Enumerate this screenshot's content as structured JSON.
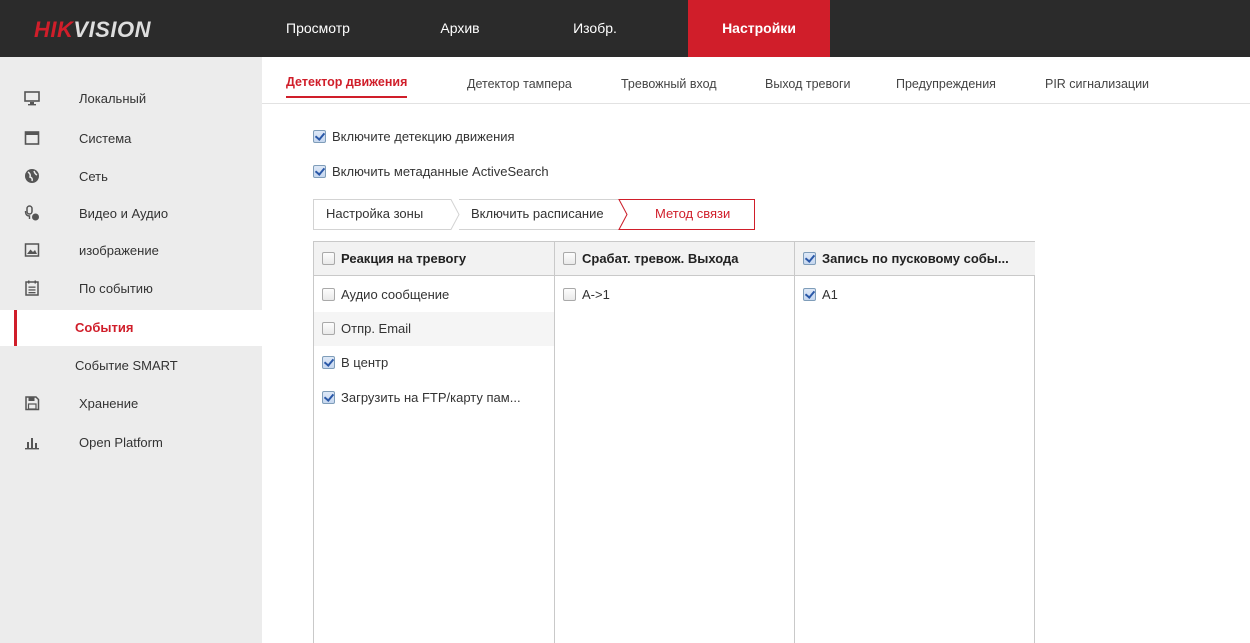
{
  "brand": {
    "logo_red": "HIK",
    "logo_rest": "VISION"
  },
  "topnav": [
    {
      "label": "Просмотр",
      "active": false
    },
    {
      "label": "Архив",
      "active": false
    },
    {
      "label": "Изобр.",
      "active": false
    },
    {
      "label": "Настройки",
      "active": true
    }
  ],
  "sidebar": [
    {
      "label": "Локальный",
      "icon": "monitor-icon"
    },
    {
      "label": "Система",
      "icon": "window-icon"
    },
    {
      "label": "Сеть",
      "icon": "globe-icon"
    },
    {
      "label": "Видео и Аудио",
      "icon": "mic-camera-icon"
    },
    {
      "label": "изображение",
      "icon": "image-icon"
    },
    {
      "label": "По событию",
      "icon": "calendar-icon"
    },
    {
      "label": "События",
      "active": true
    },
    {
      "label": "Событие SMART"
    },
    {
      "label": "Хранение",
      "icon": "save-icon"
    },
    {
      "label": "Open Platform",
      "icon": "bar-chart-icon"
    }
  ],
  "subtabs": [
    {
      "label": "Детектор движения",
      "active": true
    },
    {
      "label": "Детектор тампера"
    },
    {
      "label": "Тревожный вход"
    },
    {
      "label": "Выход тревоги"
    },
    {
      "label": "Предупреждения"
    },
    {
      "label": "PIR сигнализации"
    }
  ],
  "options": {
    "enable_motion": {
      "label": "Включите детекцию движения",
      "checked": true
    },
    "enable_metadata": {
      "label": "Включить метаданные ActiveSearch",
      "checked": true
    }
  },
  "steps": [
    {
      "label": "Настройка зоны"
    },
    {
      "label": "Включить расписание"
    },
    {
      "label": "Метод связи",
      "active": true
    }
  ],
  "table": {
    "columns": [
      {
        "title": "Реакция на тревогу",
        "checked": false
      },
      {
        "title": "Срабат. тревож. Выхода",
        "checked": false
      },
      {
        "title": "Запись по пусковому собы...",
        "checked": true
      }
    ],
    "col1": [
      {
        "label": "Аудио сообщение",
        "checked": false
      },
      {
        "label": "Отпр. Email",
        "checked": false
      },
      {
        "label": "В центр",
        "checked": true
      },
      {
        "label": "Загрузить на FTP/карту пам...",
        "checked": false,
        "checked_visual": true
      }
    ],
    "col2": [
      {
        "label": "A->1",
        "checked": false
      }
    ],
    "col3": [
      {
        "label": "A1",
        "checked": true
      }
    ]
  },
  "colors": {
    "accent": "#d01e2a",
    "topbar": "#2b2b2b",
    "sidebar": "#ececec"
  }
}
